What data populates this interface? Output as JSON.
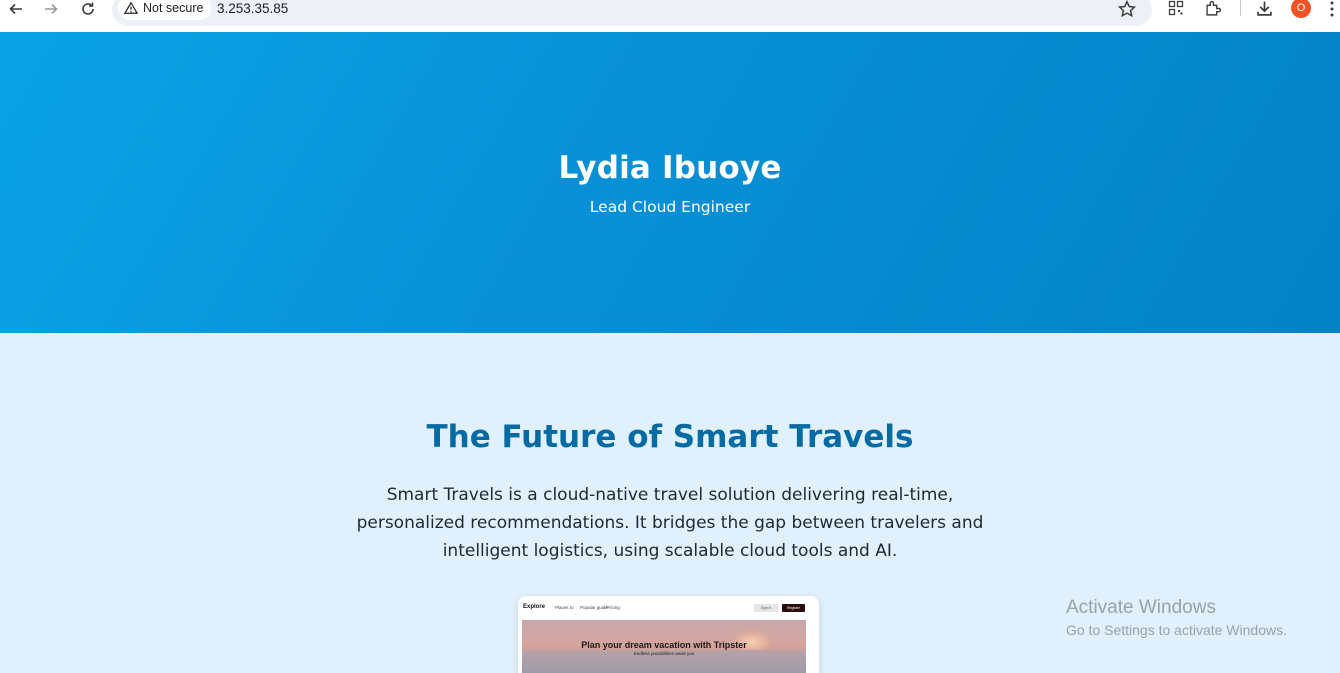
{
  "browser": {
    "security_label": "Not secure",
    "url": "3.253.35.85",
    "profile_initial": "O",
    "icons": [
      "back-icon",
      "forward-icon",
      "reload-icon",
      "warning-icon",
      "star-icon",
      "qr-code-icon",
      "extensions-icon",
      "download-icon",
      "menu-dots-icon"
    ]
  },
  "hero": {
    "name": "Lydia Ibuoye",
    "role": "Lead Cloud Engineer",
    "gradient_colors": [
      "#0aa3e6",
      "#0382c6"
    ]
  },
  "about": {
    "title": "The Future of Smart Travels",
    "description": "Smart Travels is a cloud-native travel solution delivering real-time, personalized recommendations. It bridges the gap between travelers and intelligent logistics, using scalable cloud tools and AI.",
    "title_color": "#066aa3"
  },
  "preview": {
    "logo": "Explore",
    "nav_links": [
      "Places to",
      "Popular guide",
      "Pricing"
    ],
    "button_light": "Sign in",
    "button_dark": "Register",
    "headline": "Plan your dream vacation with Tripster",
    "subline": "Endless possibilities await you"
  },
  "watermark": {
    "title": "Activate Windows",
    "subtitle": "Go to Settings to activate Windows."
  }
}
